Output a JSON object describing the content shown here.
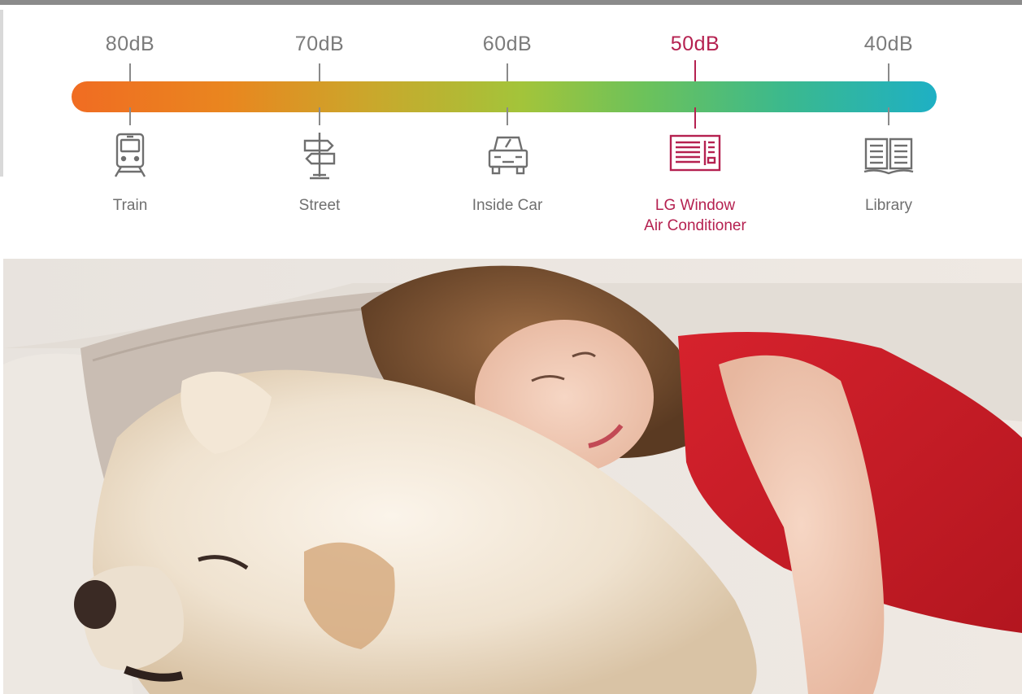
{
  "noise_scale": {
    "highlight_color": "#b52150",
    "gradient_colors": [
      "#f06c22",
      "#a3c43a",
      "#1eb0c4"
    ],
    "stops": [
      {
        "db": "80dB",
        "label_line1": "Train",
        "label_line2": "",
        "icon": "train-icon",
        "highlight": false
      },
      {
        "db": "70dB",
        "label_line1": "Street",
        "label_line2": "",
        "icon": "street-sign-icon",
        "highlight": false
      },
      {
        "db": "60dB",
        "label_line1": "Inside Car",
        "label_line2": "",
        "icon": "car-icon",
        "highlight": false
      },
      {
        "db": "50dB",
        "label_line1": "LG Window",
        "label_line2": "Air Conditioner",
        "icon": "air-conditioner-icon",
        "highlight": true
      },
      {
        "db": "40dB",
        "label_line1": "Library",
        "label_line2": "",
        "icon": "book-icon",
        "highlight": false
      }
    ]
  },
  "photo": {
    "subject": "sleeping-girl-and-dog-photo"
  }
}
